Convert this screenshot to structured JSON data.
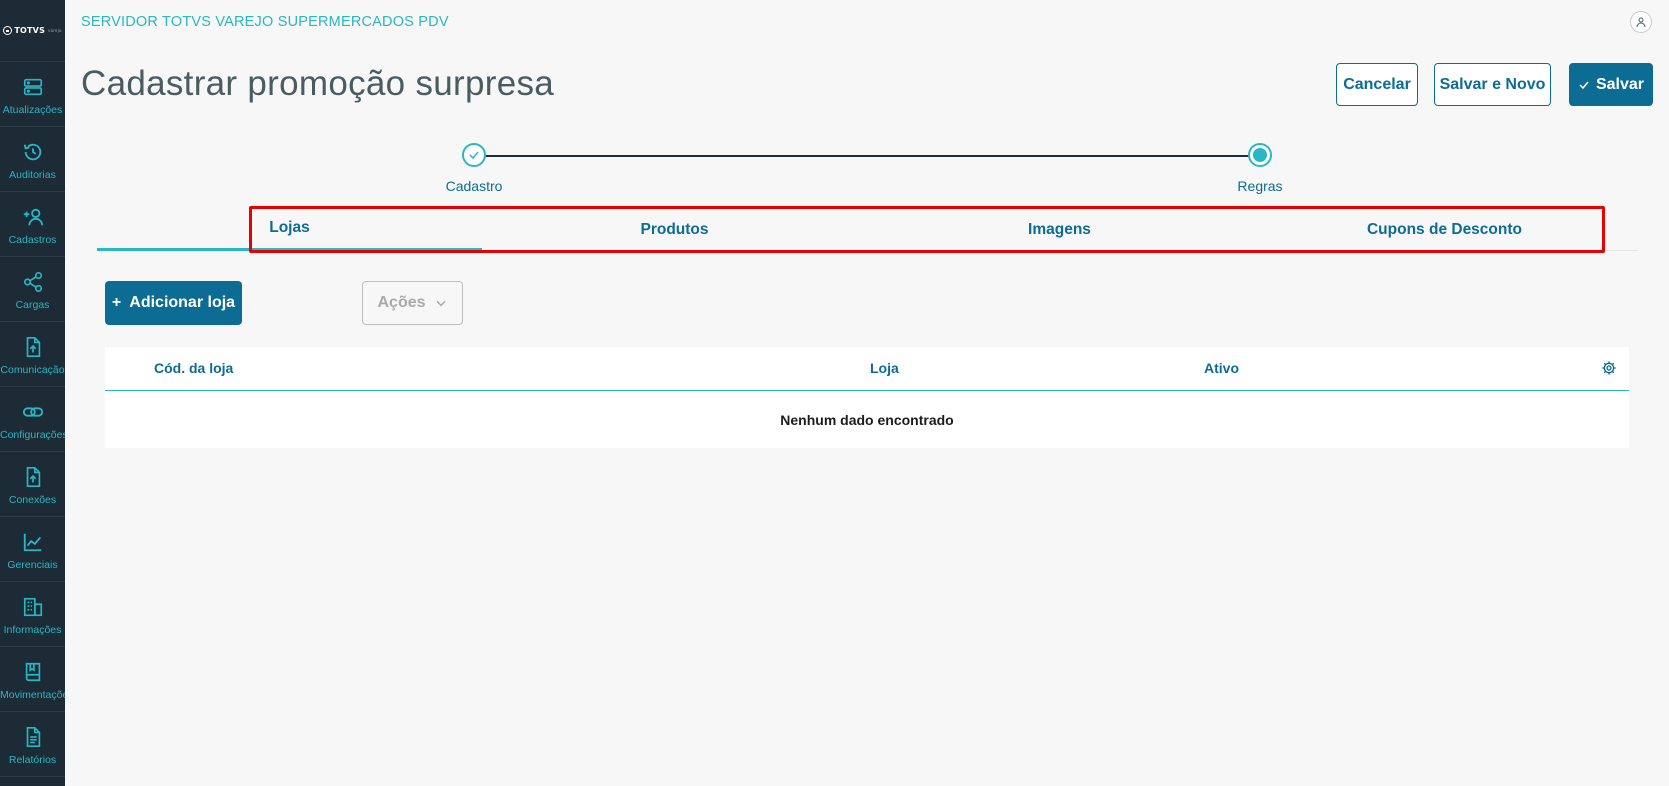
{
  "sidebar": {
    "logo": {
      "brand": "TOTVS",
      "sub": "varejo"
    },
    "items": [
      {
        "label": "Atualizações",
        "icon": "server-icon"
      },
      {
        "label": "Auditorias",
        "icon": "history-icon"
      },
      {
        "label": "Cadastros",
        "icon": "add-user-icon"
      },
      {
        "label": "Cargas",
        "icon": "share-icon"
      },
      {
        "label": "Comunicação",
        "icon": "file-upload-icon"
      },
      {
        "label": "Configurações",
        "icon": "link-icon"
      },
      {
        "label": "Conexões",
        "icon": "file-upload-icon"
      },
      {
        "label": "Gerenciais",
        "icon": "chart-icon"
      },
      {
        "label": "Informações",
        "icon": "building-icon"
      },
      {
        "label": "Movimentações",
        "icon": "book-icon"
      },
      {
        "label": "Relatórios",
        "icon": "document-icon"
      }
    ]
  },
  "header": {
    "app_title": "SERVIDOR TOTVS VAREJO SUPERMERCADOS PDV",
    "page_title": "Cadastrar promoção surpresa"
  },
  "actions": {
    "cancel": "Cancelar",
    "save_new": "Salvar e Novo",
    "save": "Salvar"
  },
  "stepper": {
    "steps": [
      {
        "label": "Cadastro",
        "state": "done"
      },
      {
        "label": "Regras",
        "state": "current"
      }
    ]
  },
  "tabs": [
    {
      "label": "Lojas",
      "active": true
    },
    {
      "label": "Produtos",
      "active": false
    },
    {
      "label": "Imagens",
      "active": false
    },
    {
      "label": "Cupons de Desconto",
      "active": false
    }
  ],
  "toolbar": {
    "add_store": "Adicionar loja",
    "actions": "Ações"
  },
  "table": {
    "columns": [
      "Cód. da loja",
      "Loja",
      "Ativo"
    ],
    "empty_message": "Nenhum dado encontrado"
  },
  "colors": {
    "primary": "#0c6c94",
    "accent": "#29b6c5",
    "sidebar_bg": "#1c2b35",
    "highlight": "#e60000"
  }
}
